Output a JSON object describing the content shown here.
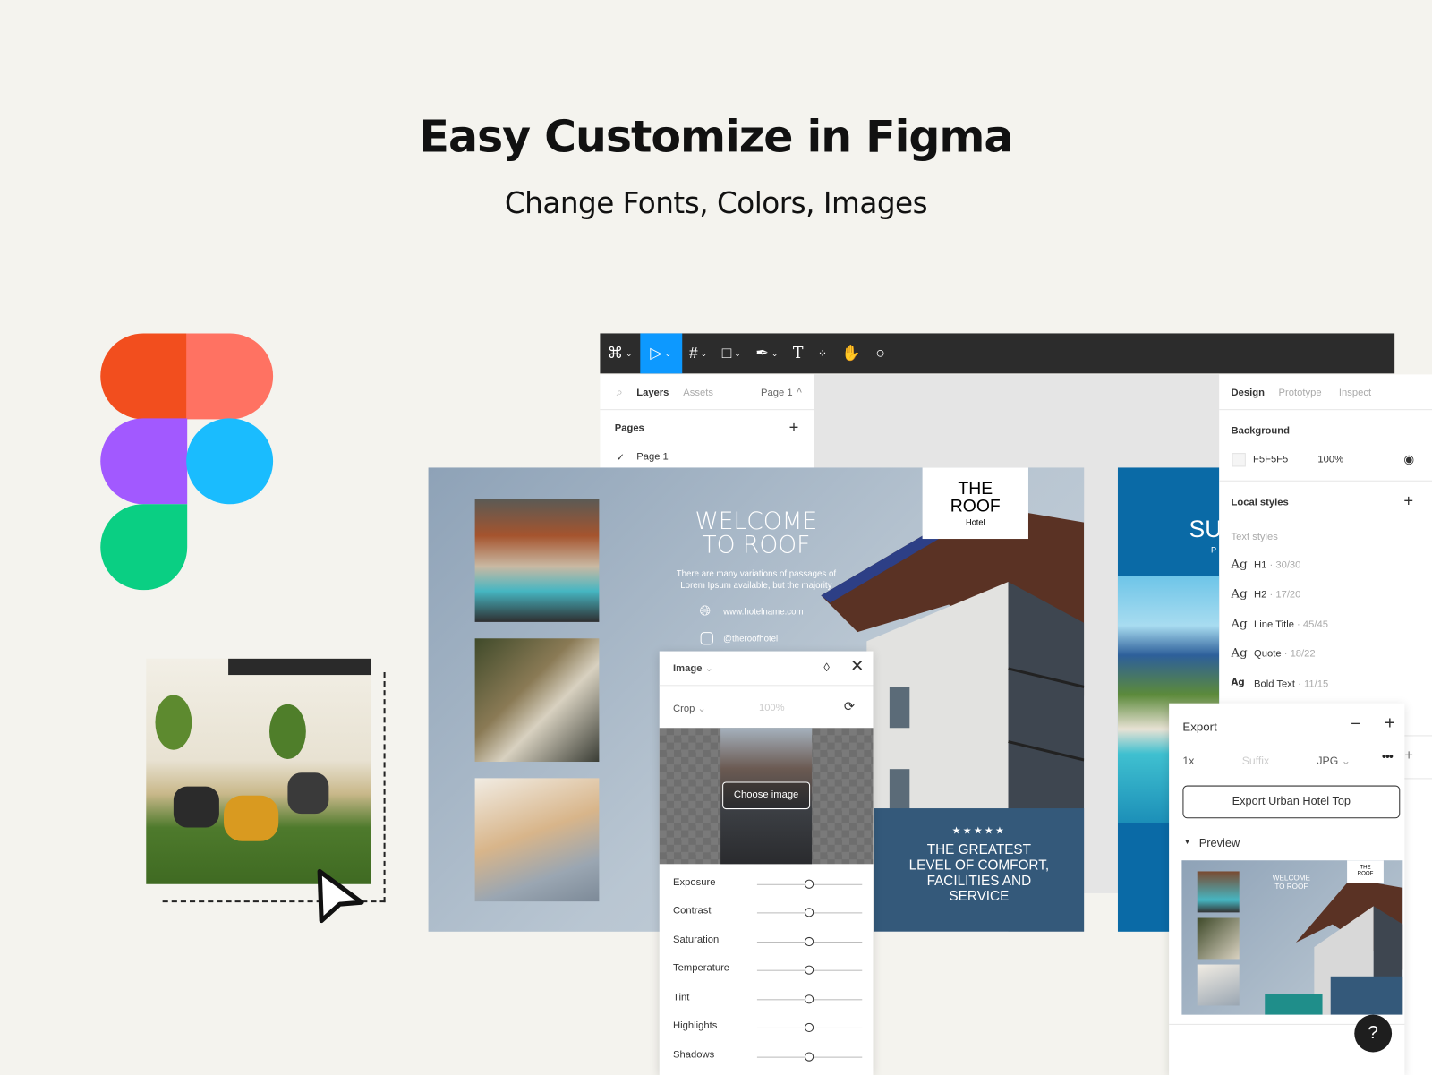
{
  "hero": {
    "title": "Easy Customize in Figma",
    "subtitle": "Change Fonts, Colors, Images"
  },
  "brand_colors": {
    "figma_red": "#F24E1E",
    "figma_salmon": "#FF7262",
    "figma_purple": "#A259FF",
    "figma_blue": "#1ABCFE",
    "figma_green": "#0ACF83",
    "toolbar_accent": "#0D99FF"
  },
  "toolbar": {
    "tools": [
      "figma-menu-icon",
      "move-tool-icon",
      "frame-tool-icon",
      "shape-tool-icon",
      "pen-tool-icon",
      "text-tool-icon",
      "components-icon",
      "hand-tool-icon",
      "comment-icon"
    ]
  },
  "left_panel": {
    "tabs": [
      "Layers",
      "Assets"
    ],
    "page_selector": "Page 1",
    "pages_label": "Pages",
    "pages": [
      "Page 1"
    ]
  },
  "design_frame": {
    "title_line1": "WELCOME",
    "title_line2": "TO ROOF",
    "paragraph_line1": "There are many variations of passages of",
    "paragraph_line2": "Lorem Ipsum available, but the majority",
    "website": "www.hotelname.com",
    "instagram": "@theroofhotel",
    "logo_line1": "THE",
    "logo_line2": "ROOF",
    "logo_sub": "Hotel",
    "stars": "★★★★★",
    "tagline": [
      "THE GREATEST",
      "LEVEL OF COMFORT,",
      "FACILITIES AND",
      "SERVICE"
    ]
  },
  "second_frame": {
    "title": "SU",
    "sub": "P"
  },
  "image_panel": {
    "title": "Image",
    "crop_label": "Crop",
    "crop_value": "100%",
    "choose_image": "Choose image",
    "sliders": [
      {
        "label": "Exposure",
        "value": 0
      },
      {
        "label": "Contrast",
        "value": 0
      },
      {
        "label": "Saturation",
        "value": 0
      },
      {
        "label": "Temperature",
        "value": 0
      },
      {
        "label": "Tint",
        "value": 0
      },
      {
        "label": "Highlights",
        "value": 0
      },
      {
        "label": "Shadows",
        "value": 0
      }
    ]
  },
  "right_panel": {
    "tabs": [
      "Design",
      "Prototype",
      "Inspect"
    ],
    "background_label": "Background",
    "bg_hex": "F5F5F5",
    "bg_opacity": "100%",
    "local_styles": "Local styles",
    "text_styles": "Text styles",
    "styles": [
      {
        "ag": "Ag",
        "name": "H1",
        "spec": " · 30/30"
      },
      {
        "ag": "Ag",
        "name": "H2",
        "spec": " · 17/20"
      },
      {
        "ag": "Ag",
        "name": "Line Title",
        "spec": " · 45/45"
      },
      {
        "ag": "Ag",
        "name": "Quote",
        "spec": " · 18/22"
      },
      {
        "ag": "Ag",
        "name": "Bold Text",
        "spec": " · 11/15"
      }
    ]
  },
  "export_panel": {
    "title": "Export",
    "scale": "1x",
    "suffix_placeholder": "Suffix",
    "format": "JPG",
    "export_button": "Export Urban Hotel Top",
    "preview_label": "Preview",
    "preview": {
      "title1": "WELCOME",
      "title2": "TO ROOF",
      "logo1": "THE",
      "logo2": "ROOF"
    }
  },
  "help_button": "?"
}
